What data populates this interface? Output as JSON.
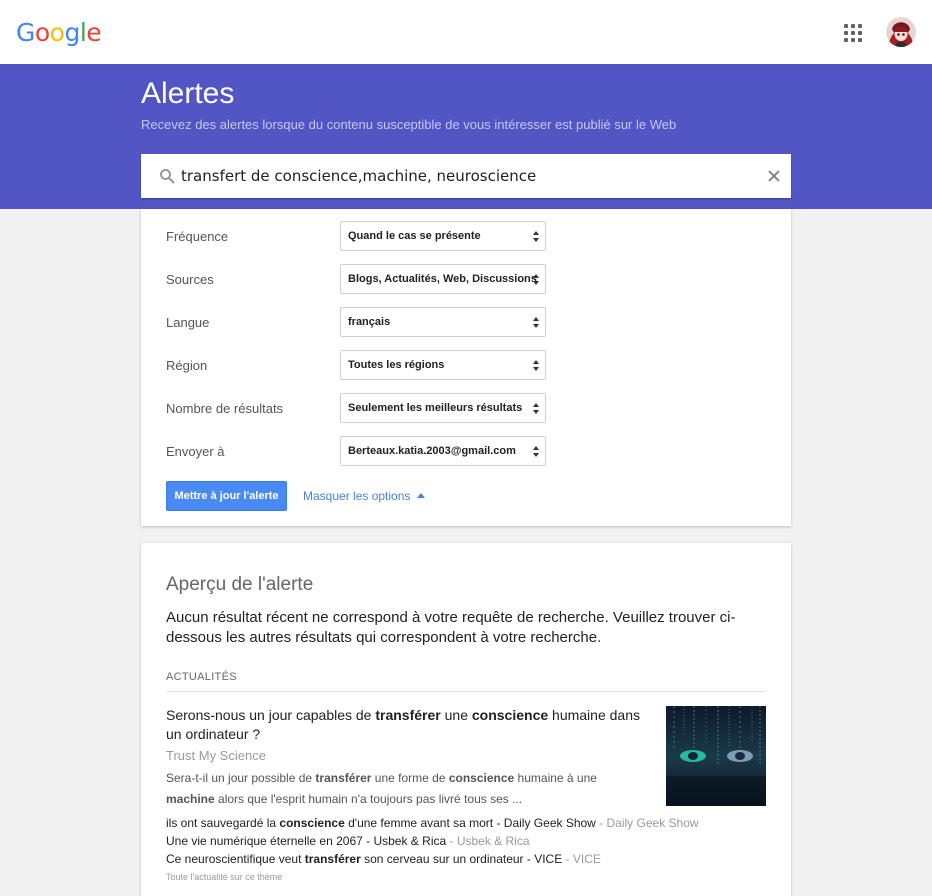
{
  "header": {
    "logo_letters": [
      "G",
      "o",
      "o",
      "g",
      "l",
      "e"
    ],
    "apps_icon": "apps-grid-icon",
    "avatar_icon": "user-avatar"
  },
  "banner": {
    "title": "Alertes",
    "subtitle": "Recevez des alertes lorsque du contenu susceptible de vous intéresser est publié sur le Web",
    "color": "#5256c4"
  },
  "search": {
    "value": "transfert de conscience,machine, neuroscience"
  },
  "options": {
    "items": [
      {
        "label": "Fréquence",
        "value": "Quand le cas se présente"
      },
      {
        "label": "Sources",
        "value": "Blogs, Actualités, Web, Discussions"
      },
      {
        "label": "Langue",
        "value": "français"
      },
      {
        "label": "Région",
        "value": "Toutes les régions"
      },
      {
        "label": "Nombre de résultats",
        "value": "Seulement les meilleurs résultats"
      },
      {
        "label": "Envoyer à",
        "value": "Berteaux.katia.2003@gmail.com"
      }
    ],
    "update_button": "Mettre à jour l'alerte",
    "hide_link": "Masquer les options"
  },
  "preview": {
    "title": "Aperçu de l'alerte",
    "no_result": "Aucun résultat récent ne correspond à votre requête de recherche. Veuillez trouver ci-dessous les autres résultats qui correspondent à votre recherche.",
    "section": "ACTUALITÉS",
    "article": {
      "title_parts": [
        "Serons-nous un jour capables de ",
        "transférer",
        " une ",
        "conscience",
        " humaine dans un ordinateur ?"
      ],
      "source": "Trust My Science",
      "snippet_parts": [
        "Sera-t-il un jour possible de ",
        "transférer",
        " une forme de ",
        "conscience",
        " humaine à une ",
        "machine",
        " alors que l'esprit humain n'a toujours pas livré tous ses ..."
      ]
    },
    "more": [
      {
        "parts": [
          "ils ont sauvegardé la ",
          "conscience",
          " d'une femme avant sa mort - Daily Geek Show"
        ],
        "source": " - Daily Geek Show"
      },
      {
        "parts": [
          "Une vie numérique éternelle en 2067 - Usbek & Rica"
        ],
        "source": " - Usbek & Rica"
      },
      {
        "parts": [
          "Ce neuroscientifique veut ",
          "transférer",
          " son cerveau sur un ordinateur - VICE"
        ],
        "source": " - VICE"
      }
    ],
    "all_news": "Toute l'actualité sur ce thème"
  }
}
